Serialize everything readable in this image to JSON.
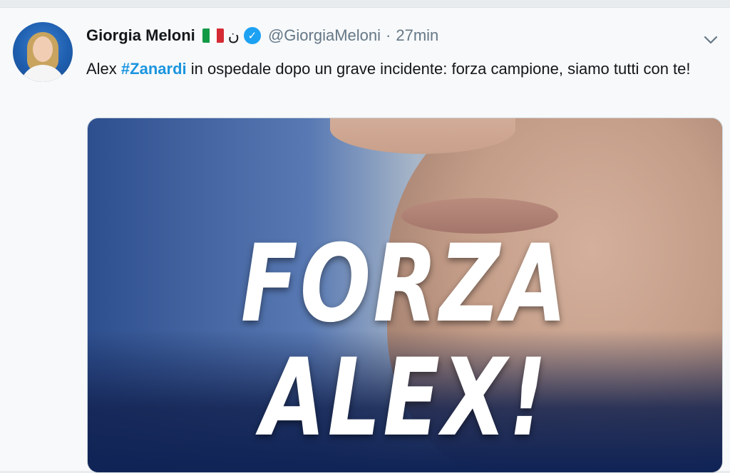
{
  "tweet": {
    "author_name": "Giorgia Meloni",
    "name_extra": "ن",
    "handle": "@GiorgiaMeloni",
    "separator": "·",
    "time": "27min",
    "text_before": "Alex ",
    "hashtag": "#Zanardi",
    "text_after": " in ospedale dopo un grave incidente: forza campione, siamo tutti con te!",
    "media_text": "FORZA ALEX!"
  },
  "icons": {
    "flag": "italy-flag-icon",
    "verified": "verified-badge-icon",
    "more": "chevron-down-icon"
  },
  "colors": {
    "hashtag": "#1b95e0",
    "verified": "#1da1f2",
    "handle": "#657786",
    "flag_green": "#119a46",
    "flag_white": "#ffffff",
    "flag_red": "#d52b35"
  }
}
